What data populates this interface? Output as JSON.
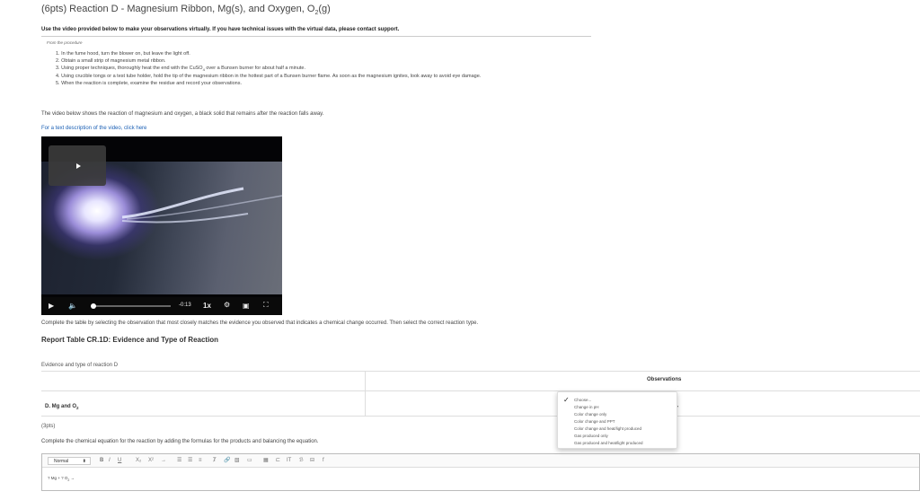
{
  "page": {
    "title": "(6pts) Reaction D - Magnesium Ribbon, Mg(s), and Oxygen, O",
    "title_sub": "2",
    "title_tail": "(g)",
    "instructions": "Use the video provided below to make your observations virtually. If you have technical issues with the virtual data, please contact support."
  },
  "procedure": {
    "header": "From the procedure",
    "steps": [
      "1. In the fume hood, turn the blower on, but leave the light off.",
      "2. Obtain a small strip of magnesium metal ribbon.",
      "3. Using proper techniques, thoroughly heat the end with the CuSO",
      "4. Using crucible tongs or a test tube holder, hold the tip of the magnesium ribbon in the hottest part of a Bunsen burner flame. As soon as the magnesium ignites, look away to avoid eye damage.",
      "5. When the reaction is complete, examine the residue and record your observations."
    ],
    "step3_sub": "4",
    "step3_tail": " over a Bunsen burner for about half a minute."
  },
  "video": {
    "description": "The video below shows the reaction of magnesium and oxygen, a black solid that remains after the reaction falls away.",
    "text_link": "For a text description of the video, click here",
    "time": "-0:13",
    "speed": "1x",
    "progress": 0.02
  },
  "table": {
    "complete_instructions": "Complete the table by selecting the observation that most closely matches the evidence you observed that indicates a chemical change occurred. Then select the correct reaction type.",
    "title": "Report Table CR.1D: Evidence and Type of Reaction",
    "evidence_label": "Evidence and type of reaction D",
    "observations_header": "Observations",
    "row_label": "D. Mg and O",
    "row_label_sub": "2"
  },
  "dropdown": {
    "options": [
      "Choose...",
      "Change in pH",
      "Color change only",
      "Color change and PPT",
      "Color change and heat/light produced",
      "Gas produced only",
      "Gas produced and heat/light produced"
    ],
    "selected_index": 0
  },
  "equation": {
    "points": "(3pts)",
    "instructions": "Complete the chemical equation for the reaction by adding the formulas for the products and balancing the equation.",
    "format": "Normal",
    "text": "? Mg + ? O",
    "text_sub": "2",
    "text_tail": " →"
  },
  "colors": {
    "link": "#1a5fb4",
    "accent": "#2a7ae2"
  }
}
